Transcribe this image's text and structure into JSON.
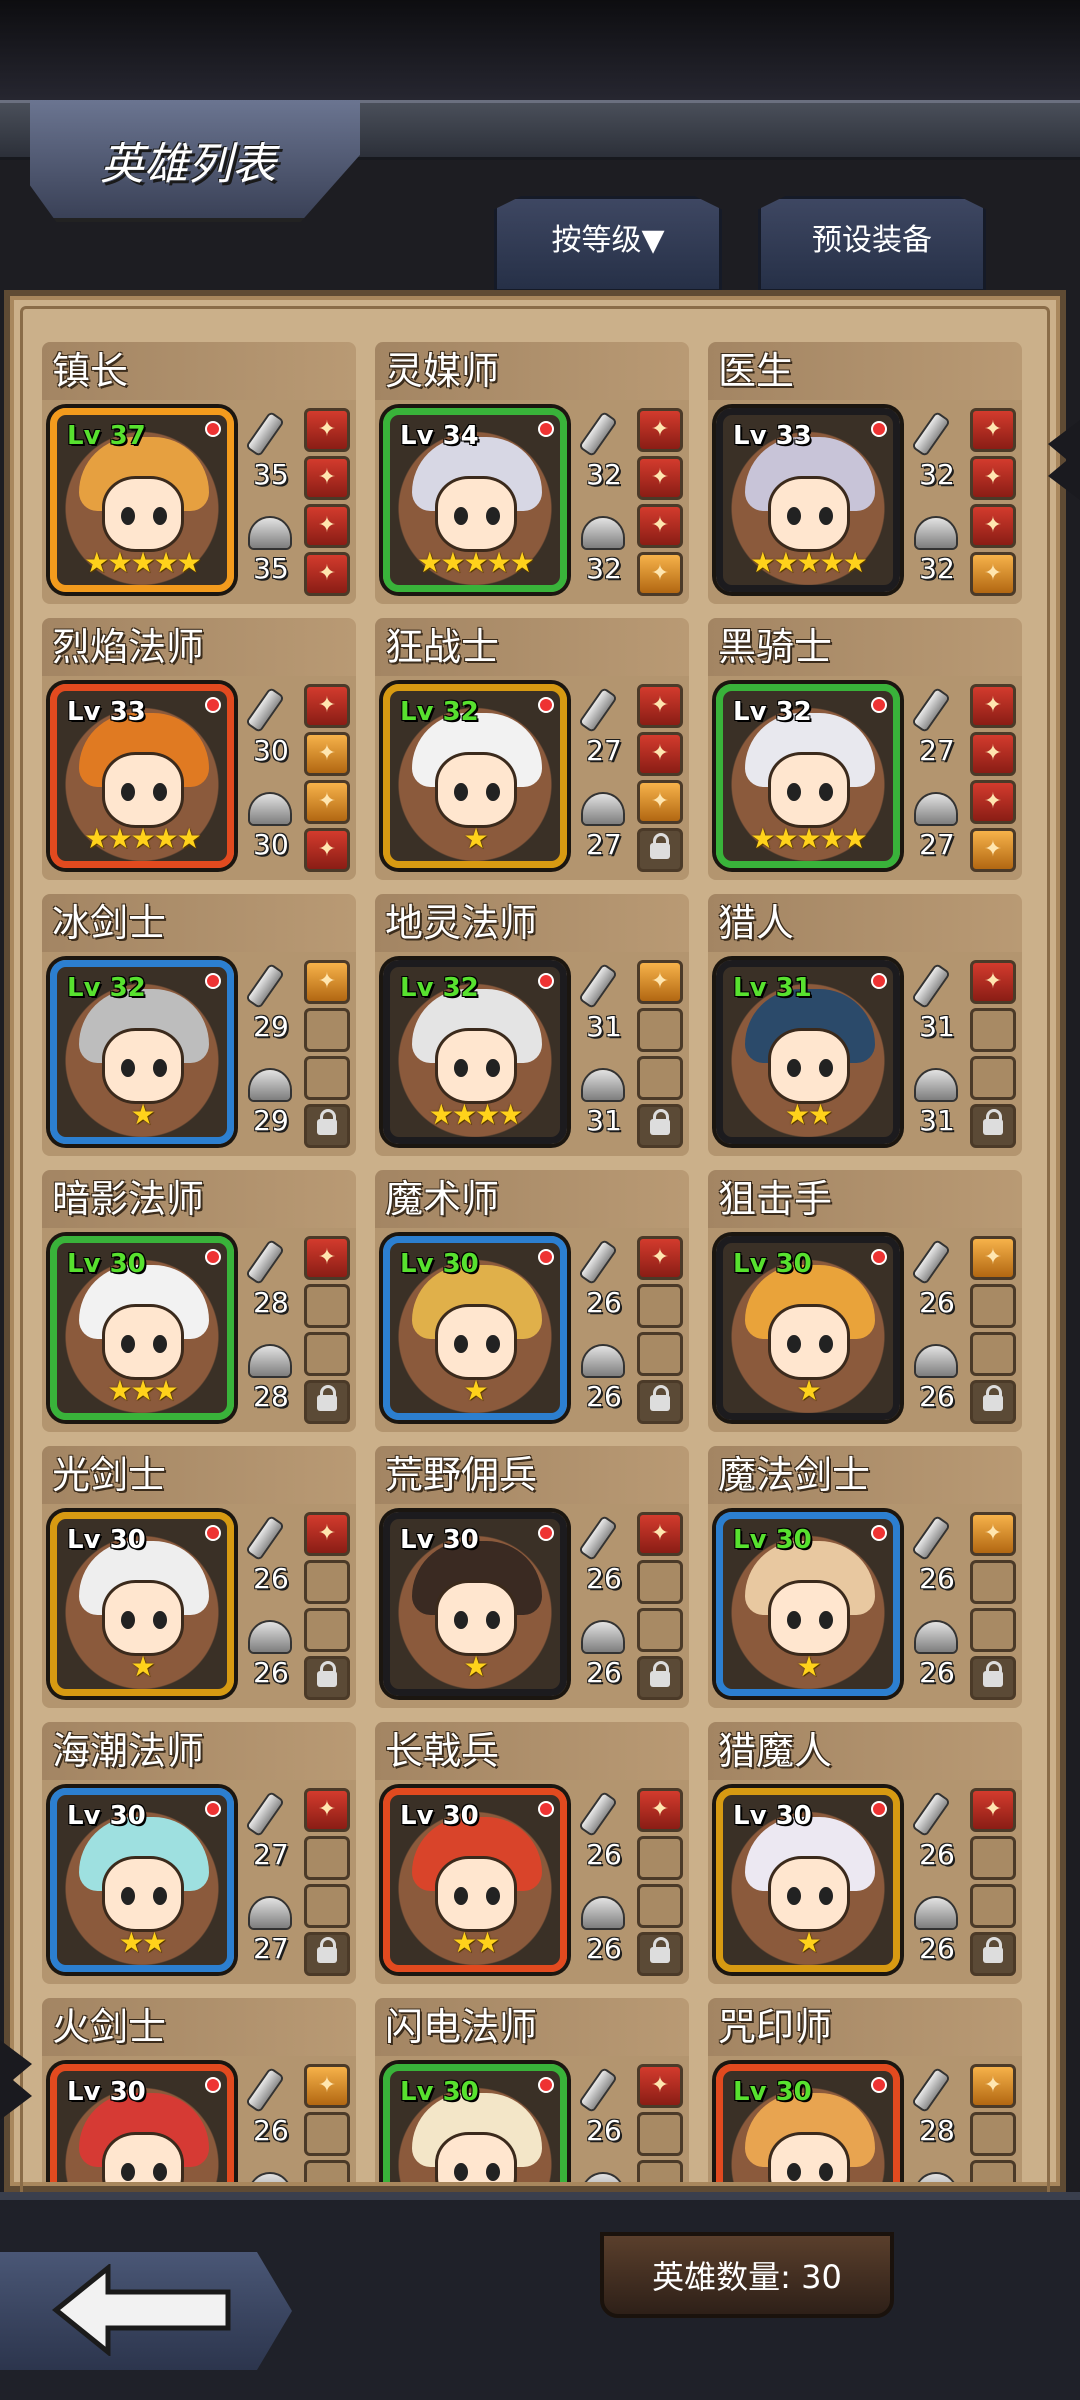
{
  "header": {
    "title": "英雄列表",
    "sort_label": "按等级▼",
    "preset_label": "预设装备"
  },
  "footer": {
    "hero_count": "英雄数量: 30"
  },
  "heroes": [
    {
      "name": "镇长",
      "level": "Lv 37",
      "level_color": "green",
      "atk": "35",
      "def": "35",
      "stars": "★★★★★",
      "frame": "#f39b1d",
      "hair": "#e6a040",
      "slots": [
        "filled",
        "filled",
        "filled",
        "filled"
      ]
    },
    {
      "name": "灵媒师",
      "level": "Lv 34",
      "level_color": "white",
      "atk": "32",
      "def": "32",
      "stars": "★★★★★",
      "frame": "#39b33a",
      "hair": "#d7d7e4",
      "slots": [
        "filled",
        "filled",
        "filled",
        "gold"
      ]
    },
    {
      "name": "医生",
      "level": "Lv 33",
      "level_color": "white",
      "atk": "32",
      "def": "32",
      "stars": "★★★★★",
      "frame": "#1c1b1e",
      "hair": "#c8c4d8",
      "slots": [
        "filled",
        "filled",
        "filled",
        "gold"
      ]
    },
    {
      "name": "烈焰法师",
      "level": "Lv 33",
      "level_color": "white",
      "atk": "30",
      "def": "30",
      "stars": "★★★★★",
      "frame": "#e24a1f",
      "hair": "#e07a22",
      "slots": [
        "filled",
        "gold",
        "gold",
        "filled"
      ]
    },
    {
      "name": "狂战士",
      "level": "Lv 32",
      "level_color": "green",
      "atk": "27",
      "def": "27",
      "stars": "★",
      "frame": "#d79a12",
      "hair": "#f2f2f2",
      "slots": [
        "filled",
        "filled",
        "gold",
        "lock"
      ]
    },
    {
      "name": "黑骑士",
      "level": "Lv 32",
      "level_color": "white",
      "atk": "27",
      "def": "27",
      "stars": "★★★★★",
      "frame": "#39b33a",
      "hair": "#e8e8ee",
      "slots": [
        "filled",
        "filled",
        "filled",
        "gold"
      ]
    },
    {
      "name": "冰剑士",
      "level": "Lv 32",
      "level_color": "green",
      "atk": "29",
      "def": "29",
      "stars": "★",
      "frame": "#2c7fd0",
      "hair": "#bdbdbd",
      "slots": [
        "gold",
        "empty",
        "empty",
        "lock"
      ]
    },
    {
      "name": "地灵法师",
      "level": "Lv 32",
      "level_color": "green",
      "atk": "31",
      "def": "31",
      "stars": "★★★★",
      "frame": "#1c1b1e",
      "hair": "#e4e4e4",
      "slots": [
        "gold",
        "empty",
        "empty",
        "lock"
      ]
    },
    {
      "name": "猎人",
      "level": "Lv 31",
      "level_color": "green",
      "atk": "31",
      "def": "31",
      "stars": "★★",
      "frame": "#1c1b1e",
      "hair": "#2b4a6a",
      "slots": [
        "filled",
        "empty",
        "empty",
        "lock"
      ]
    },
    {
      "name": "暗影法师",
      "level": "Lv 30",
      "level_color": "green",
      "atk": "28",
      "def": "28",
      "stars": "★★★",
      "frame": "#39b33a",
      "hair": "#f2f2f2",
      "slots": [
        "filled",
        "empty",
        "empty",
        "lock"
      ]
    },
    {
      "name": "魔术师",
      "level": "Lv 30",
      "level_color": "green",
      "atk": "26",
      "def": "26",
      "stars": "★",
      "frame": "#2c7fd0",
      "hair": "#e0b04a",
      "slots": [
        "filled",
        "empty",
        "empty",
        "lock"
      ]
    },
    {
      "name": "狙击手",
      "level": "Lv 30",
      "level_color": "green",
      "atk": "26",
      "def": "26",
      "stars": "★",
      "frame": "#1c1b1e",
      "hair": "#e9a33a",
      "slots": [
        "gold",
        "empty",
        "empty",
        "lock"
      ]
    },
    {
      "name": "光剑士",
      "level": "Lv 30",
      "level_color": "white",
      "atk": "26",
      "def": "26",
      "stars": "★",
      "frame": "#d79a12",
      "hair": "#eeeeee",
      "slots": [
        "filled",
        "empty",
        "empty",
        "lock"
      ]
    },
    {
      "name": "荒野佣兵",
      "level": "Lv 30",
      "level_color": "white",
      "atk": "26",
      "def": "26",
      "stars": "★",
      "frame": "#1c1b1e",
      "hair": "#3a2a22",
      "slots": [
        "filled",
        "empty",
        "empty",
        "lock"
      ]
    },
    {
      "name": "魔法剑士",
      "level": "Lv 30",
      "level_color": "green",
      "atk": "26",
      "def": "26",
      "stars": "★",
      "frame": "#2c7fd0",
      "hair": "#e8c8a0",
      "slots": [
        "gold",
        "empty",
        "empty",
        "lock"
      ]
    },
    {
      "name": "海潮法师",
      "level": "Lv 30",
      "level_color": "white",
      "atk": "27",
      "def": "27",
      "stars": "★★",
      "frame": "#2c7fd0",
      "hair": "#9ee0e0",
      "slots": [
        "filled",
        "empty",
        "empty",
        "lock"
      ]
    },
    {
      "name": "长戟兵",
      "level": "Lv 30",
      "level_color": "white",
      "atk": "26",
      "def": "26",
      "stars": "★★",
      "frame": "#e24a1f",
      "hair": "#d9442a",
      "slots": [
        "filled",
        "empty",
        "empty",
        "lock"
      ]
    },
    {
      "name": "猎魔人",
      "level": "Lv 30",
      "level_color": "white",
      "atk": "26",
      "def": "26",
      "stars": "★",
      "frame": "#d79a12",
      "hair": "#ece8f2",
      "slots": [
        "filled",
        "empty",
        "empty",
        "lock"
      ]
    },
    {
      "name": "火剑士",
      "level": "Lv 30",
      "level_color": "white",
      "atk": "26",
      "def": "",
      "stars": "",
      "frame": "#e24a1f",
      "hair": "#d63a34",
      "slots": [
        "gold",
        "empty",
        "empty",
        "empty"
      ]
    },
    {
      "name": "闪电法师",
      "level": "Lv 30",
      "level_color": "green",
      "atk": "26",
      "def": "",
      "stars": "",
      "frame": "#39b33a",
      "hair": "#f3e6c8",
      "slots": [
        "filled",
        "empty",
        "empty",
        "empty"
      ]
    },
    {
      "name": "咒印师",
      "level": "Lv 30",
      "level_color": "green",
      "atk": "28",
      "def": "",
      "stars": "",
      "frame": "#e24a1f",
      "hair": "#e8a450",
      "slots": [
        "gold",
        "empty",
        "empty",
        "empty"
      ]
    }
  ]
}
